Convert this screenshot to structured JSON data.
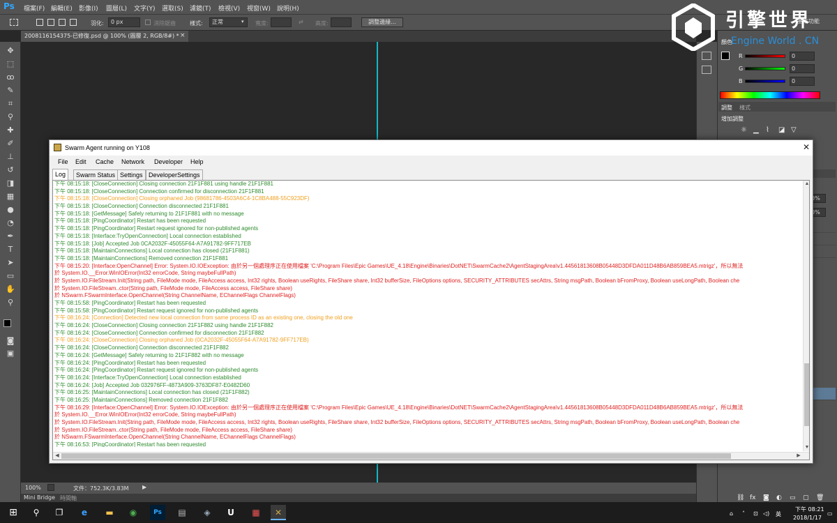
{
  "app": {
    "logo": "Ps",
    "menu": [
      "檔案(F)",
      "編輯(E)",
      "影像(I)",
      "圖層(L)",
      "文字(Y)",
      "選取(S)",
      "濾鏡(T)",
      "檢視(V)",
      "視窗(W)",
      "說明(H)"
    ]
  },
  "options": {
    "feather_label": "羽化:",
    "feather_value": "0 px",
    "antialias_label": "消除鋸齒",
    "style_label": "樣式:",
    "style_value": "正常",
    "width_label": "寬度:",
    "height_label": "高度:",
    "refine_button": "調整邊緣...",
    "workspace_label": "基本功能"
  },
  "document": {
    "tab_title": "20081161543​75-已修復.psd @ 100% (圖層 2, RGB/8#) *",
    "zoom": "100%",
    "file_info": "文件：752.3K/3.83M"
  },
  "bottom": {
    "mini_bridge": "Mini Bridge",
    "timeline": "時間軸"
  },
  "watermark": {
    "chinese": "引擎世界",
    "english": "Engine World . CN"
  },
  "right_panel": {
    "color_tab": "顏色",
    "r_label": "R",
    "g_label": "G",
    "b_label": "B",
    "r_value": "0",
    "g_value": "0",
    "b_value": "0",
    "adjust_tab": "調整",
    "style_tab": "樣式",
    "add_adjustment": "增加調整",
    "opacity_1": "0%",
    "opacity_2": "0%"
  },
  "swarm": {
    "title": "Swarm Agent running on Y108",
    "menu": [
      "File",
      "Edit",
      "Cache",
      "Network",
      "Developer",
      "Help"
    ],
    "tabs": [
      "Log",
      "Swarm Status",
      "Settings",
      "DeveloperSettings"
    ],
    "log": [
      {
        "text": "下午 08:15:18: [CloseConnection] Closing connection 21F1F881 using handle 21F1F881",
        "color": "green"
      },
      {
        "text": "下午 08:15:18: [CloseConnection] Connection confirmed for disconnection 21F1F881",
        "color": "green"
      },
      {
        "text": "下午 08:15:18: [CloseConnection] Closing orphaned Job (98681786-4503A6C4-1C8BA488-55C923DF)",
        "color": "orange"
      },
      {
        "text": "下午 08:15:18: [CloseConnection] Connection disconnected 21F1F881",
        "color": "green"
      },
      {
        "text": "下午 08:15:18: [GetMessage] Safely returning to 21F1F881 with no message",
        "color": "green"
      },
      {
        "text": "下午 08:15:18: [PingCoordinator] Restart has been requested",
        "color": "green"
      },
      {
        "text": "下午 08:15:18: [PingCoordinator] Restart request ignored for non-published agents",
        "color": "green"
      },
      {
        "text": "下午 08:15:18: [Interface:TryOpenConnection] Local connection established",
        "color": "green"
      },
      {
        "text": "下午 08:15:18: [Job] Accepted Job 0CA2032F-45055F64-A7A91782-9FF717EB",
        "color": "green"
      },
      {
        "text": "下午 08:15:18: [MaintainConnections] Local connection has closed (21F1F881)",
        "color": "green"
      },
      {
        "text": "下午 08:15:18: [MaintainConnections] Removed connection 21F1F881",
        "color": "green"
      },
      {
        "text": "下午 08:15:20: [Interface:OpenChannel] Error: System.IO.IOException: 由於另一個處理序正在使用檔案 'C:\\Program Files\\Epic Games\\UE_4.18\\Engine\\Binaries\\DotNET\\SwarmCache2\\AgentStagingArea\\v1.44561813608B05448D3DFDA011D48B6AB859BEA5.mtrigz'，所以無法",
        "color": "red"
      },
      {
        "text": "   於 System.IO.__Error.WinIOError(Int32 errorCode, String maybeFullPath)",
        "color": "red"
      },
      {
        "text": "   於 System.IO.FileStream.Init(String path, FileMode mode, FileAccess access, Int32 rights, Boolean useRights, FileShare share, Int32 bufferSize, FileOptions options, SECURITY_ATTRIBUTES secAttrs, String msgPath, Boolean bFromProxy, Boolean useLongPath, Boolean che",
        "color": "red"
      },
      {
        "text": "   於 System.IO.FileStream..ctor(String path, FileMode mode, FileAccess access, FileShare share)",
        "color": "red"
      },
      {
        "text": "   於 NSwarm.FSwarmInterface.OpenChannel(String ChannelName, EChannelFlags ChannelFlags)",
        "color": "red"
      },
      {
        "text": "下午 08:15:58: [PingCoordinator] Restart has been requested",
        "color": "green"
      },
      {
        "text": "下午 08:15:58: [PingCoordinator] Restart request ignored for non-published agents",
        "color": "green"
      },
      {
        "text": "下午 08:16:24: [Connection] Detected new local connection from same process ID as an existing one, closing the old one",
        "color": "orange"
      },
      {
        "text": "下午 08:16:24: [CloseConnection] Closing connection 21F1F882 using handle 21F1F882",
        "color": "green"
      },
      {
        "text": "下午 08:16:24: [CloseConnection] Connection confirmed for disconnection 21F1F882",
        "color": "green"
      },
      {
        "text": "下午 08:16:24: [CloseConnection] Closing orphaned Job (0CA2032F-45055F64-A7A91782-9FF717EB)",
        "color": "orange"
      },
      {
        "text": "下午 08:16:24: [CloseConnection] Connection disconnected 21F1F882",
        "color": "green"
      },
      {
        "text": "下午 08:16:24: [GetMessage] Safely returning to 21F1F882 with no message",
        "color": "green"
      },
      {
        "text": "下午 08:16:24: [PingCoordinator] Restart has been requested",
        "color": "green"
      },
      {
        "text": "下午 08:16:24: [PingCoordinator] Restart request ignored for non-published agents",
        "color": "green"
      },
      {
        "text": "下午 08:16:24: [Interface:TryOpenConnection] Local connection established",
        "color": "green"
      },
      {
        "text": "下午 08:16:24: [Job] Accepted Job 032976FF-4873A909-3763DF87-E0482D60",
        "color": "green"
      },
      {
        "text": "下午 08:16:25: [MaintainConnections] Local connection has closed (21F1F882)",
        "color": "green"
      },
      {
        "text": "下午 08:16:25: [MaintainConnections] Removed connection 21F1F882",
        "color": "green"
      },
      {
        "text": "下午 08:16:29: [Interface:OpenChannel] Error: System.IO.IOException: 由於另一個處理序正在使用檔案 'C:\\Program Files\\Epic Games\\UE_4.18\\Engine\\Binaries\\DotNET\\SwarmCache2\\AgentStagingArea\\v1.44561813608B05448D3DFDA011D48B6AB859BEA5.mtrigz'，所以無法",
        "color": "red"
      },
      {
        "text": "   於 System.IO.__Error.WinIOError(Int32 errorCode, String maybeFullPath)",
        "color": "red"
      },
      {
        "text": "   於 System.IO.FileStream.Init(String path, FileMode mode, FileAccess access, Int32 rights, Boolean useRights, FileShare share, Int32 bufferSize, FileOptions options, SECURITY_ATTRIBUTES secAttrs, String msgPath, Boolean bFromProxy, Boolean useLongPath, Boolean che",
        "color": "red"
      },
      {
        "text": "   於 System.IO.FileStream..ctor(String path, FileMode mode, FileAccess access, FileShare share)",
        "color": "red"
      },
      {
        "text": "   於 NSwarm.FSwarmInterface.OpenChannel(String ChannelName, EChannelFlags ChannelFlags)",
        "color": "red"
      },
      {
        "text": "下午 08:16:53: [PingCoordinator] Restart has been requested",
        "color": "green"
      }
    ]
  },
  "taskbar": {
    "time": "下午 08:21",
    "date": "2018/1/17",
    "lang": "英"
  }
}
